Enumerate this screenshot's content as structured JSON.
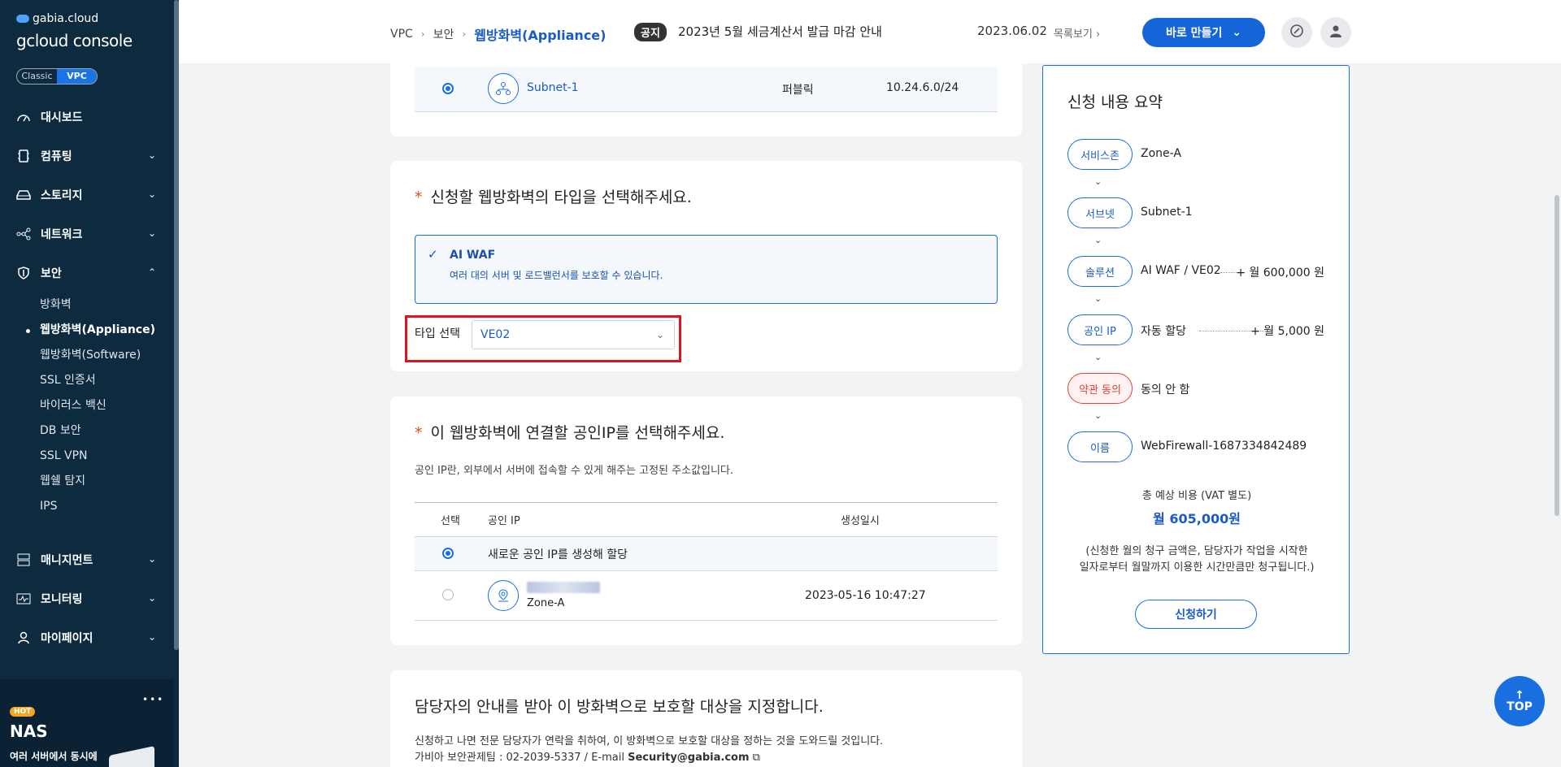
{
  "sidebar": {
    "brand_small": "gabia.cloud",
    "brand_big": "gcloud console",
    "toggle_classic": "Classic",
    "toggle_vpc": "VPC",
    "items": [
      {
        "label": "대시보드"
      },
      {
        "label": "컴퓨팅"
      },
      {
        "label": "스토리지"
      },
      {
        "label": "네트워크"
      },
      {
        "label": "보안"
      },
      {
        "label": "매니지먼트"
      },
      {
        "label": "모니터링"
      },
      {
        "label": "마이페이지"
      }
    ],
    "security_sub": [
      {
        "label": "방화벽"
      },
      {
        "label": "웹방화벽(Appliance)"
      },
      {
        "label": "웹방화벽(Software)"
      },
      {
        "label": "SSL 인증서"
      },
      {
        "label": "바이러스 백신"
      },
      {
        "label": "DB 보안"
      },
      {
        "label": "SSL VPN"
      },
      {
        "label": "웹쉘 탐지"
      },
      {
        "label": "IPS"
      }
    ],
    "promo": {
      "badge": "HOT",
      "title": "NAS",
      "desc": "여러 서버에서 동시에",
      "dots": "•••"
    }
  },
  "header": {
    "breadcrumb": [
      "VPC",
      "보안",
      "웹방화벽(Appliance)"
    ],
    "notice_tag": "공지",
    "notice_text": "2023년 5월 세금계산서 발급 마감 안내",
    "notice_date": "2023.06.02",
    "notice_more": "목록보기",
    "create_button": "바로 만들기"
  },
  "subnet_row": {
    "name": "Subnet-1",
    "type": "퍼블릭",
    "cidr": "10.24.6.0/24"
  },
  "waf_section": {
    "required": "*",
    "title": "신청할 웹방화벽의 타입을 선택해주세요.",
    "option_title": "AI WAF",
    "option_desc": "여러 대의 서버 및 로드밸런서를 보호할 수 있습니다.",
    "type_label": "타입 선택",
    "type_value": "VE02"
  },
  "ip_section": {
    "required": "*",
    "title": "이 웹방화벽에 연결할 공인IP를 선택해주세요.",
    "desc": "공인 IP란, 외부에서 서버에 접속할 수 있게 해주는 고정된 주소값입니다.",
    "columns": {
      "select": "선택",
      "ip": "공인 IP",
      "created": "생성일시"
    },
    "row_new": "새로운 공인 IP를 생성해 할당",
    "row_zone": "Zone-A",
    "row_created": "2023-05-16 10:47:27"
  },
  "target_section": {
    "title": "담당자의 안내를 받아 이 방화벽으로 보호할 대상을 지정합니다.",
    "desc1": "신청하고 나면 전문 담당자가 연락을 취하여, 이 방화벽으로 보호할 대상을 정하는 것을 도와드릴 것입니다.",
    "desc2_prefix": "가비아 보안관제팀 : 02-2039-5337 / E-mail ",
    "desc2_email": "Security@gabia.com"
  },
  "summary": {
    "title": "신청 내용 요약",
    "rows": [
      {
        "pill": "서비스존",
        "value": "Zone-A",
        "price": ""
      },
      {
        "pill": "서브넷",
        "value": "Subnet-1",
        "price": ""
      },
      {
        "pill": "솔루션",
        "value": "AI WAF / VE02",
        "price": "+ 월 600,000 원"
      },
      {
        "pill": "공인 IP",
        "value": "자동 할당",
        "price": "+ 월 5,000 원"
      },
      {
        "pill": "약관 동의",
        "value": "동의 안 함",
        "price": ""
      },
      {
        "pill": "이름",
        "value": "WebFirewall-1687334842489",
        "price": ""
      }
    ],
    "total_label": "총 예상 비용 (VAT 별도)",
    "total_value": "월 605,000원",
    "note1": "(신청한 월의 청구 금액은, 담당자가 작업을 시작한",
    "note2": "일자로부터 월말까지 이용한 시간만큼만 청구됩니다.)",
    "apply_button": "신청하기"
  },
  "top_button": "TOP",
  "colors": {
    "sidebar_bg": "#0d2a3f",
    "accent": "#1a6fe0",
    "highlight": "#e0121c"
  }
}
